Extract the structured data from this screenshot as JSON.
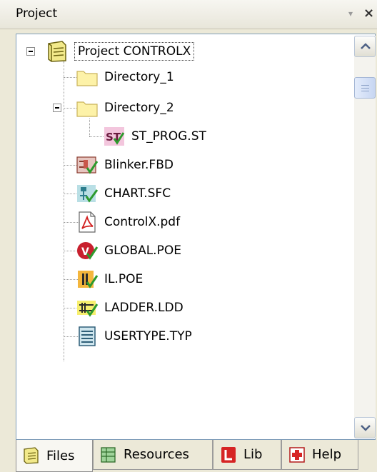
{
  "window": {
    "title": "Project",
    "pin_glyph": "▾",
    "close_glyph": "×"
  },
  "tree": {
    "root": {
      "label": "Project CONTROLX",
      "icon": "project-book-icon",
      "expanded": true
    },
    "items": [
      {
        "label": "Directory_1",
        "icon": "folder-icon"
      },
      {
        "label": "Directory_2",
        "icon": "folder-icon",
        "expanded": true
      },
      {
        "label": "ST_PROG.ST",
        "icon": "st-program-icon"
      },
      {
        "label": "Blinker.FBD",
        "icon": "fbd-icon"
      },
      {
        "label": "CHART.SFC",
        "icon": "sfc-icon"
      },
      {
        "label": "ControlX.pdf",
        "icon": "pdf-icon"
      },
      {
        "label": "GLOBAL.POE",
        "icon": "global-poe-icon"
      },
      {
        "label": "IL.POE",
        "icon": "il-poe-icon"
      },
      {
        "label": "LADDER.LDD",
        "icon": "ladder-icon"
      },
      {
        "label": "USERTYPE.TYP",
        "icon": "usertype-icon"
      }
    ]
  },
  "tabs": [
    {
      "label": "Files",
      "icon": "files-icon",
      "active": true
    },
    {
      "label": "Resources",
      "icon": "resources-icon",
      "active": false
    },
    {
      "label": "Lib",
      "icon": "lib-icon",
      "active": false
    },
    {
      "label": "Help",
      "icon": "help-icon",
      "active": false
    }
  ],
  "colors": {
    "folder": "#fdf2a8",
    "selection_border": "#444444",
    "panel_border": "#7f9db9"
  }
}
